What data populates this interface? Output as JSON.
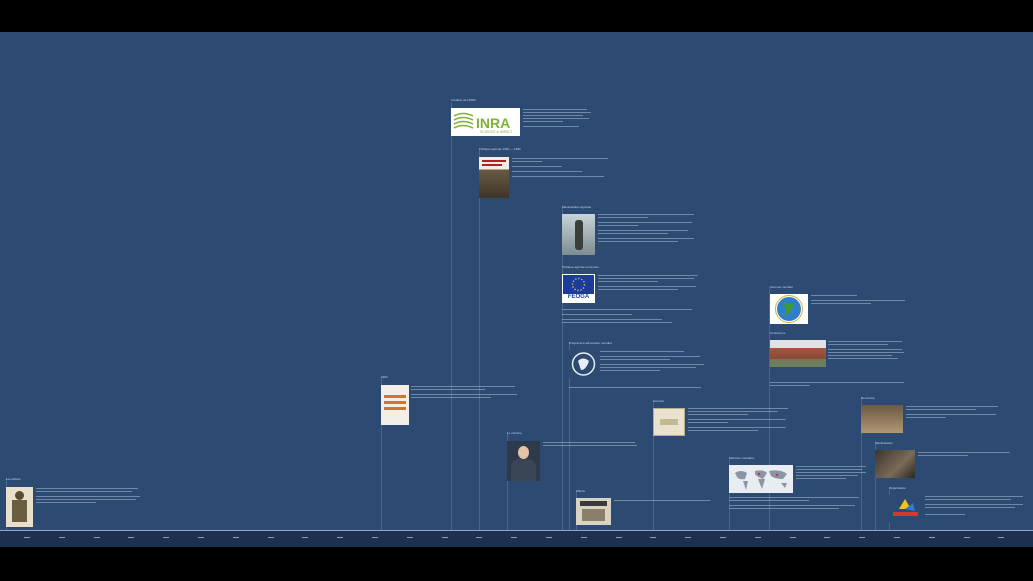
{
  "theme": {
    "background": "#2c4a72",
    "axis_background": "#1c3150",
    "letterbox": "#000000"
  },
  "timeline": {
    "events": [
      {
        "id": "inra",
        "title": "Création de l'INRA",
        "image": "inra-logo",
        "logo_text": "INRA",
        "logo_sub": "SCIENCE & IMPACT"
      },
      {
        "id": "book-red",
        "title": "Politique agricole 1960 — 1962",
        "image": "book-cover-photo"
      },
      {
        "id": "statue",
        "title": "Mécanisation agricole",
        "image": "statue-photo"
      },
      {
        "id": "feoga",
        "title": "Politique agricole commune",
        "image": "feoga-logo",
        "logo_text": "FEOGA"
      },
      {
        "id": "globe",
        "title": "Sommet mondial",
        "image": "globe-logo"
      },
      {
        "id": "wfp",
        "title": "Programme alimentaire mondial",
        "image": "wfp-logo"
      },
      {
        "id": "building",
        "title": "Conférence",
        "image": "building-photo"
      },
      {
        "id": "book-orange",
        "title": "1962",
        "image": "book-cover"
      },
      {
        "id": "portrait",
        "title": "Le ministre",
        "image": "portrait-photo"
      },
      {
        "id": "document",
        "title": "Accords",
        "image": "document-photo"
      },
      {
        "id": "map",
        "title": "Marchés mondiaux",
        "image": "world-map"
      },
      {
        "id": "people",
        "title": "Rencontre",
        "image": "group-photo"
      },
      {
        "id": "crowd",
        "title": "Manifestation",
        "image": "crowd-photo"
      },
      {
        "id": "poster",
        "title": "Affiche",
        "image": "poster-photo"
      },
      {
        "id": "logo-color",
        "title": "Organisation",
        "image": "color-logo"
      },
      {
        "id": "soldier",
        "title": "Les débuts",
        "image": "illustration"
      }
    ]
  }
}
